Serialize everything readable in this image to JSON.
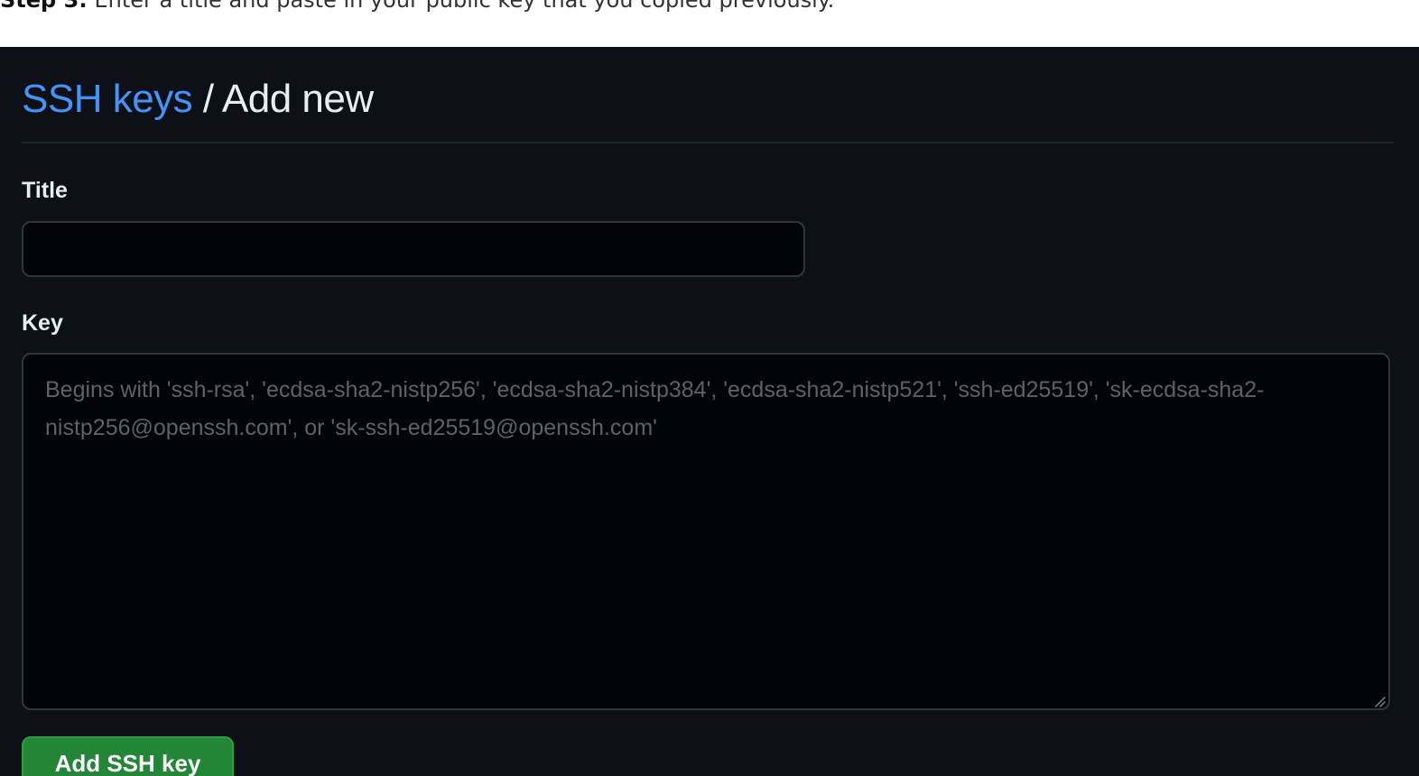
{
  "instruction": {
    "step": "Step 3:",
    "text": " Enter a title and paste in your public key that you copied previously."
  },
  "header": {
    "breadcrumb_link": "SSH keys",
    "separator": " / ",
    "current": "Add new"
  },
  "form": {
    "title_label": "Title",
    "title_value": "",
    "key_label": "Key",
    "key_value": "",
    "key_placeholder": "Begins with 'ssh-rsa', 'ecdsa-sha2-nistp256', 'ecdsa-sha2-nistp384', 'ecdsa-sha2-nistp521', 'ssh-ed25519', 'sk-ecdsa-sha2-nistp256@openssh.com', or 'sk-ssh-ed25519@openssh.com'",
    "submit_label": "Add SSH key"
  },
  "colors": {
    "panel_background": "#0d1117",
    "input_background": "#010409",
    "link": "#4493f8",
    "button": "#238636"
  },
  "icons": {
    "resize": "resize-grip-icon"
  }
}
